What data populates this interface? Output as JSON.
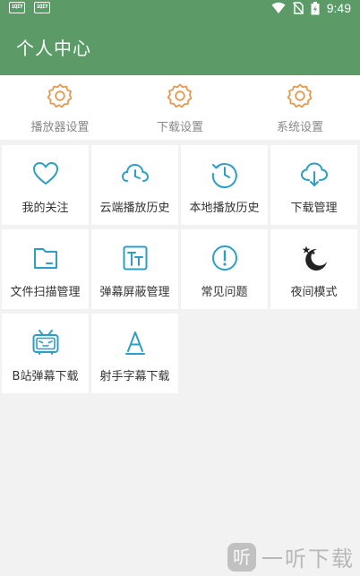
{
  "status_bar": {
    "time": "9:49",
    "left_icons": [
      "iqiyi-app-icon",
      "iqiyi-app-icon"
    ],
    "left_icon_text": "iQIY",
    "right_icons": [
      "wifi-icon",
      "no-sim-icon",
      "battery-icon"
    ]
  },
  "header": {
    "title": "个人中心"
  },
  "settings": [
    {
      "label": "播放器设置",
      "icon": "gear-icon"
    },
    {
      "label": "下载设置",
      "icon": "gear-icon"
    },
    {
      "label": "系统设置",
      "icon": "gear-icon"
    }
  ],
  "grid": [
    {
      "label": "我的关注",
      "icon": "heart-icon"
    },
    {
      "label": "云端播放历史",
      "icon": "cloud-clock-icon"
    },
    {
      "label": "本地播放历史",
      "icon": "clock-icon"
    },
    {
      "label": "下载管理",
      "icon": "cloud-download-icon"
    },
    {
      "label": "文件扫描管理",
      "icon": "folder-icon"
    },
    {
      "label": "弹幕屏蔽管理",
      "icon": "text-block-icon"
    },
    {
      "label": "常见问题",
      "icon": "exclamation-icon"
    },
    {
      "label": "夜间模式",
      "icon": "moon-stars-icon"
    },
    {
      "label": "B站弹幕下载",
      "icon": "bilibili-tv-icon"
    },
    {
      "label": "射手字幕下载",
      "icon": "font-a-icon"
    }
  ],
  "watermark": {
    "logo_text": "听",
    "text": "一听下载"
  },
  "colors": {
    "header_bg": "#5c9a68",
    "accent_blue": "#2f9ec5",
    "gear_orange": "#e39a52"
  }
}
